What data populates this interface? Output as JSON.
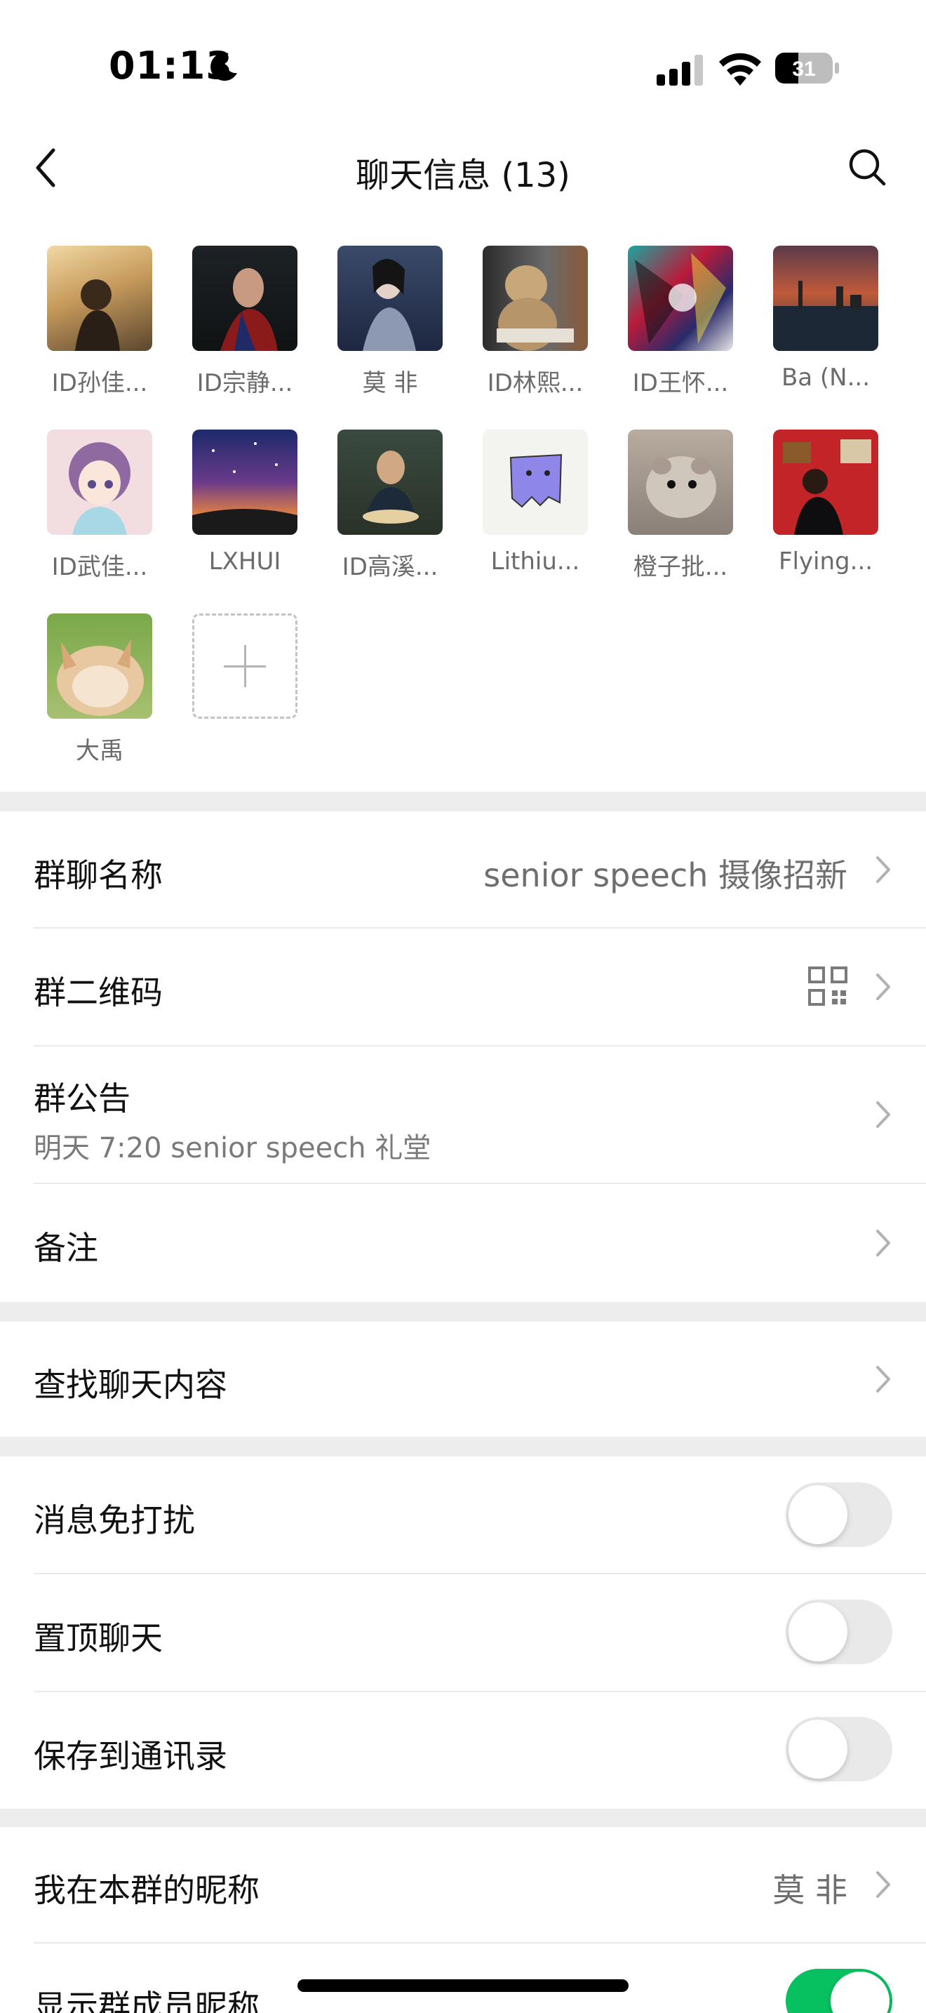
{
  "status_bar": {
    "time": "01:13",
    "battery": "31",
    "icons": [
      "moon-icon",
      "signal-icon",
      "wifi-icon",
      "battery-icon"
    ]
  },
  "nav": {
    "title": "聊天信息 (13)",
    "back_icon": "chevron-left-icon",
    "search_icon": "search-icon"
  },
  "members": [
    {
      "name": "ID孙佳..."
    },
    {
      "name": "ID宗静..."
    },
    {
      "name": "莫 非"
    },
    {
      "name": "ID林熙..."
    },
    {
      "name": "ID王怀..."
    },
    {
      "name": "Ba (N..."
    },
    {
      "name": "ID武佳..."
    },
    {
      "name": "LXHUI"
    },
    {
      "name": "ID高溪..."
    },
    {
      "name": "Lithiu..."
    },
    {
      "name": "橙子批..."
    },
    {
      "name": "Flying..."
    },
    {
      "name": "大禹"
    }
  ],
  "add_member_icon": "plus-icon",
  "settings": {
    "group_name": {
      "label": "群聊名称",
      "value": "senior speech 摄像招新"
    },
    "qr_code": {
      "label": "群二维码",
      "icon": "qr-code-icon"
    },
    "announcement": {
      "label": "群公告",
      "subtitle": "明天 7:20 senior speech 礼堂"
    },
    "remark": {
      "label": "备注"
    },
    "search_history": {
      "label": "查找聊天内容"
    },
    "mute": {
      "label": "消息免打扰",
      "on": false
    },
    "pin": {
      "label": "置顶聊天",
      "on": false
    },
    "save_contacts": {
      "label": "保存到通讯录",
      "on": false
    },
    "my_nickname": {
      "label": "我在本群的昵称",
      "value": "莫 非"
    },
    "show_nicknames": {
      "label": "显示群成员昵称",
      "on": true
    }
  },
  "colors": {
    "accent_green": "#07c160",
    "section_gap": "#ededed",
    "secondary_text": "#6e6e6e"
  }
}
